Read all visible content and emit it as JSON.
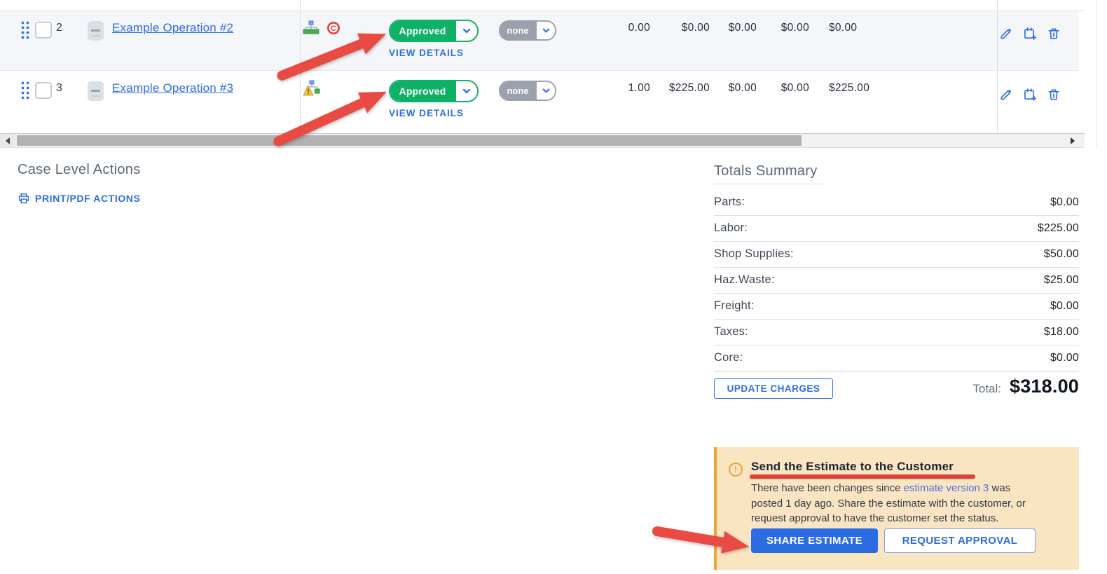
{
  "table": {
    "rows": [
      {
        "number": "2",
        "name": "Example Operation #2",
        "status": "Approved",
        "secondary_status": "none",
        "view_details": "VIEW DETAILS",
        "values": [
          "0.00",
          "$0.00",
          "$0.00",
          "$0.00",
          "$0.00"
        ],
        "c_badge_glyph": "C"
      },
      {
        "number": "3",
        "name": "Example Operation #3",
        "status": "Approved",
        "secondary_status": "none",
        "view_details": "VIEW DETAILS",
        "values": [
          "1.00",
          "$225.00",
          "$0.00",
          "$0.00",
          "$225.00"
        ]
      }
    ]
  },
  "case_actions": {
    "title": "Case Level Actions",
    "print_label": "PRINT/PDF ACTIONS"
  },
  "totals": {
    "title": "Totals Summary",
    "rows": [
      {
        "label": "Parts:",
        "value": "$0.00"
      },
      {
        "label": "Labor:",
        "value": "$225.00"
      },
      {
        "label": "Shop Supplies:",
        "value": "$50.00"
      },
      {
        "label": "Haz.Waste:",
        "value": "$25.00"
      },
      {
        "label": "Freight:",
        "value": "$0.00"
      },
      {
        "label": "Taxes:",
        "value": "$18.00"
      },
      {
        "label": "Core:",
        "value": "$0.00"
      }
    ],
    "update_button": "UPDATE CHARGES",
    "total_label": "Total:",
    "total_value": "$318.00"
  },
  "notice": {
    "title": "Send the Estimate to the Customer",
    "body_before": "There have been changes since ",
    "link": "estimate version 3",
    "body_after": " was posted 1 day ago. Share the estimate with the customer, or request approval to have the customer set the status.",
    "share_button": "SHARE ESTIMATE",
    "request_button": "REQUEST APPROVAL"
  },
  "colors": {
    "accent_blue": "#2e6de6",
    "approved_green": "#0fb167",
    "neutral_gray": "#9aa1ac",
    "annotation_red": "#e94a42",
    "notice_bg": "#fae5c2",
    "notice_border": "#f0a438"
  }
}
